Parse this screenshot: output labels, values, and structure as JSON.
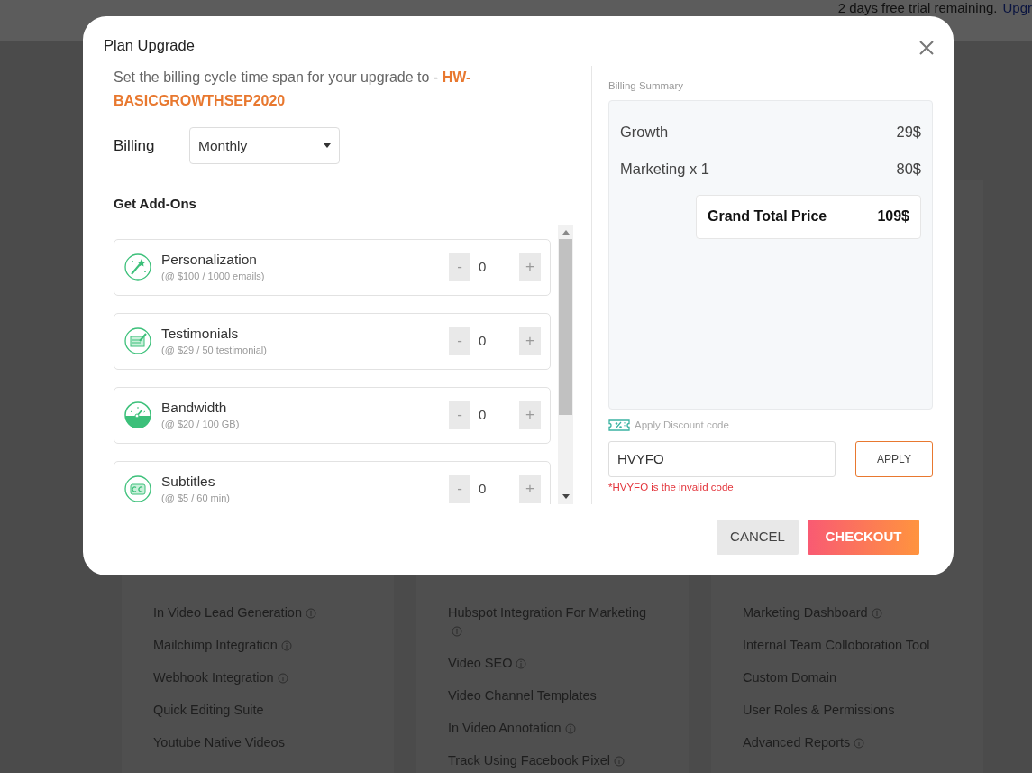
{
  "top_bar": {
    "trial_text": "2 days free trial remaining.",
    "upgrade_link": "Upgr"
  },
  "feature_columns": [
    {
      "items": [
        {
          "label": "In Video Lead Generation",
          "info": true
        },
        {
          "label": "Mailchimp Integration",
          "info": true
        },
        {
          "label": "Webhook Integration",
          "info": true
        },
        {
          "label": "Quick Editing Suite",
          "info": false
        },
        {
          "label": "Youtube Native Videos",
          "info": false
        }
      ]
    },
    {
      "items": [
        {
          "label": "Hubspot Integration For Marketing",
          "info": true
        },
        {
          "label": "Video SEO",
          "info": true
        },
        {
          "label": "Video Channel Templates",
          "info": false
        },
        {
          "label": "In Video Annotation",
          "info": true
        },
        {
          "label": "Track Using Facebook Pixel",
          "info": true
        }
      ]
    },
    {
      "items": [
        {
          "label": "Marketing Dashboard",
          "info": true
        },
        {
          "label": "Internal Team Colloboration Tool",
          "info": false
        },
        {
          "label": "Custom Domain",
          "info": false
        },
        {
          "label": "User Roles & Permissions",
          "info": false
        },
        {
          "label": "Advanced Reports",
          "info": true
        }
      ]
    }
  ],
  "modal": {
    "title": "Plan Upgrade",
    "intro": "Set the billing cycle time span for your upgrade to - **HW-BASICGROWTHSEP2020**",
    "billing_label": "Billing",
    "billing_value": "Monthly",
    "addons_title": "Get Add-Ons",
    "addons": [
      {
        "kind": "wand",
        "name": "Personalization",
        "price": "(@ $100 / 1000 emails)",
        "minus": "-",
        "quantity": "0",
        "plus": "+"
      },
      {
        "kind": "document",
        "name": "Testimonials",
        "price": "(@ $29 / 50 testimonial)",
        "minus": "-",
        "quantity": "0",
        "plus": "+"
      },
      {
        "kind": "gauge",
        "name": "Bandwidth",
        "price": "(@ $20 / 100 GB)",
        "minus": "-",
        "quantity": "0",
        "plus": "+"
      },
      {
        "kind": "cc",
        "name": "Subtitles",
        "price": "(@ $5 / 60 min)",
        "minus": "-",
        "quantity": "0",
        "plus": "+"
      }
    ],
    "summary_title": "Billing Summary",
    "summary_rows": [
      {
        "label": "Growth",
        "amount": "29$"
      },
      {
        "label": "Marketing x 1",
        "amount": "80$"
      }
    ],
    "total_label": "Grand Total Price",
    "total_amount": "109$",
    "discount_label": "Apply Discount code",
    "discount_value": "HVYFO",
    "error": "*HVYFO is the invalid code",
    "apply": "APPLY",
    "cancel": "CANCEL",
    "checkout": "CHECKOUT"
  }
}
